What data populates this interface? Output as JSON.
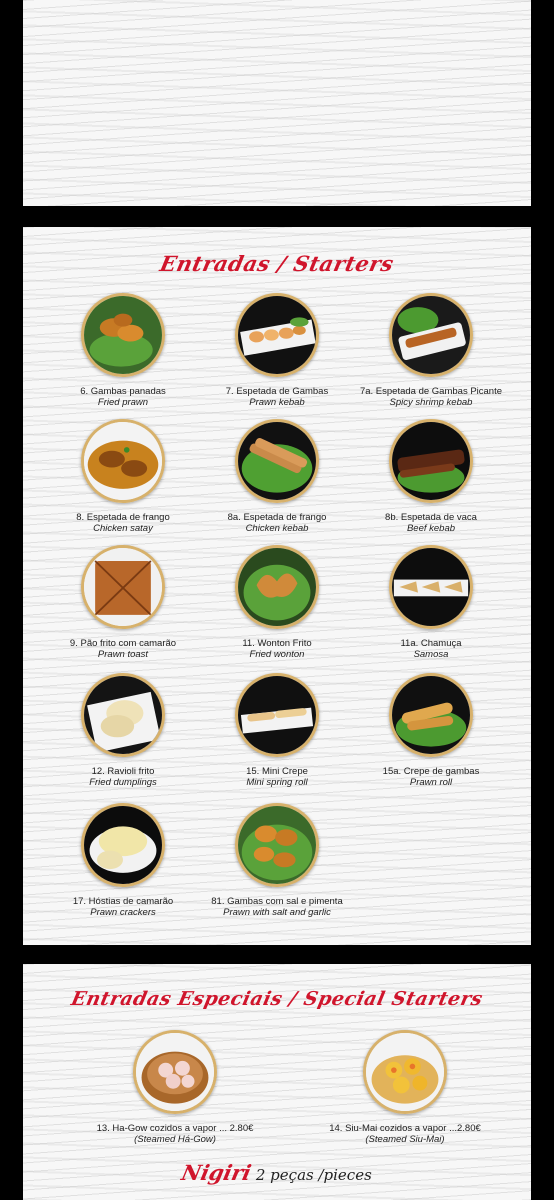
{
  "sections": {
    "starters": {
      "title": "Entradas / Starters",
      "items": [
        {
          "name": "6. Gambas panadas",
          "sub": "Fried prawn"
        },
        {
          "name": "7. Espetada de Gambas",
          "sub": "Prawn  kebab"
        },
        {
          "name": "7a. Espetada de Gambas Picante",
          "sub": "Spicy shrimp kebab"
        },
        {
          "name": "8. Espetada de frango",
          "sub": "Chicken satay"
        },
        {
          "name": "8a. Espetada de frango",
          "sub": "Chicken kebab"
        },
        {
          "name": "8b. Espetada de vaca",
          "sub": "Beef kebab"
        },
        {
          "name": "9. Pão frito com camarão",
          "sub": "Prawn toast"
        },
        {
          "name": "11. Wonton Frito",
          "sub": "Fried wonton"
        },
        {
          "name": "11a. Chamuça",
          "sub": "Samosa"
        },
        {
          "name": "12. Ravioli frito",
          "sub": "Fried dumplings"
        },
        {
          "name": "15. Mini Crepe",
          "sub": "Mini spring roll"
        },
        {
          "name": "15a. Crepe de gambas",
          "sub": "Prawn roll"
        },
        {
          "name": "17. Hóstias de camarão",
          "sub": "Prawn crackers"
        },
        {
          "name": "81. Gambas com sal e pimenta",
          "sub": "Prawn with salt and garlic"
        }
      ]
    },
    "special": {
      "title": "Entradas Especiais / Special Starters",
      "items": [
        {
          "name": "13. Ha-Gow cozidos a vapor ... 2.80€",
          "sub": "(Steamed Há-Gow)"
        },
        {
          "name": "14. Siu-Mai  cozidos a vapor ...2.80€",
          "sub": "(Steamed Siu-Mai)"
        }
      ]
    },
    "nigiri": {
      "title": "Nigiri",
      "subtitle": "2 peças /pieces"
    }
  },
  "colors": {
    "accent": "#d0152c",
    "photo_border": "#d7b16b",
    "background": "#000000",
    "page": "#f7f7f7"
  },
  "icons": {
    "dish_photo": "round-dish-photo"
  }
}
